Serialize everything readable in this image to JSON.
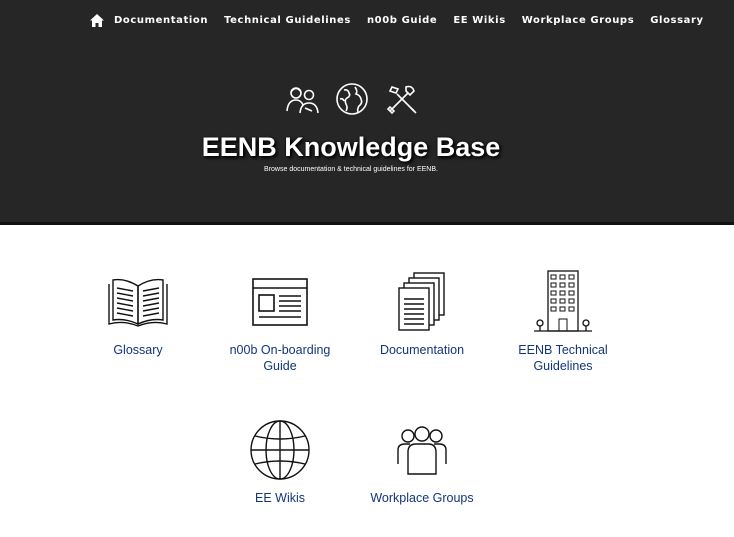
{
  "nav": {
    "home_icon": "home-icon",
    "items": [
      {
        "label": "Documentation"
      },
      {
        "label": "Technical Guidelines"
      },
      {
        "label": "n00b Guide"
      },
      {
        "label": "EE Wikis"
      },
      {
        "label": "Workplace Groups"
      },
      {
        "label": "Glossary"
      }
    ]
  },
  "hero": {
    "icons": [
      "people-icon",
      "globe-icon",
      "tools-icon"
    ],
    "title": "EENB Knowledge Base",
    "subtitle": "Browse documentation & technical guidelines for EENB."
  },
  "tiles": [
    {
      "label": "Glossary",
      "icon": "open-book-icon"
    },
    {
      "label": "n00b On-boarding Guide",
      "icon": "browser-window-icon"
    },
    {
      "label": "Documentation",
      "icon": "document-stack-icon"
    },
    {
      "label": "EENB Technical Guidelines",
      "icon": "building-icon"
    },
    {
      "label": "EE Wikis",
      "icon": "globe-icon"
    },
    {
      "label": "Workplace Groups",
      "icon": "group-icon"
    }
  ],
  "colors": {
    "hero_bg": "#262626",
    "link": "#12357a"
  }
}
